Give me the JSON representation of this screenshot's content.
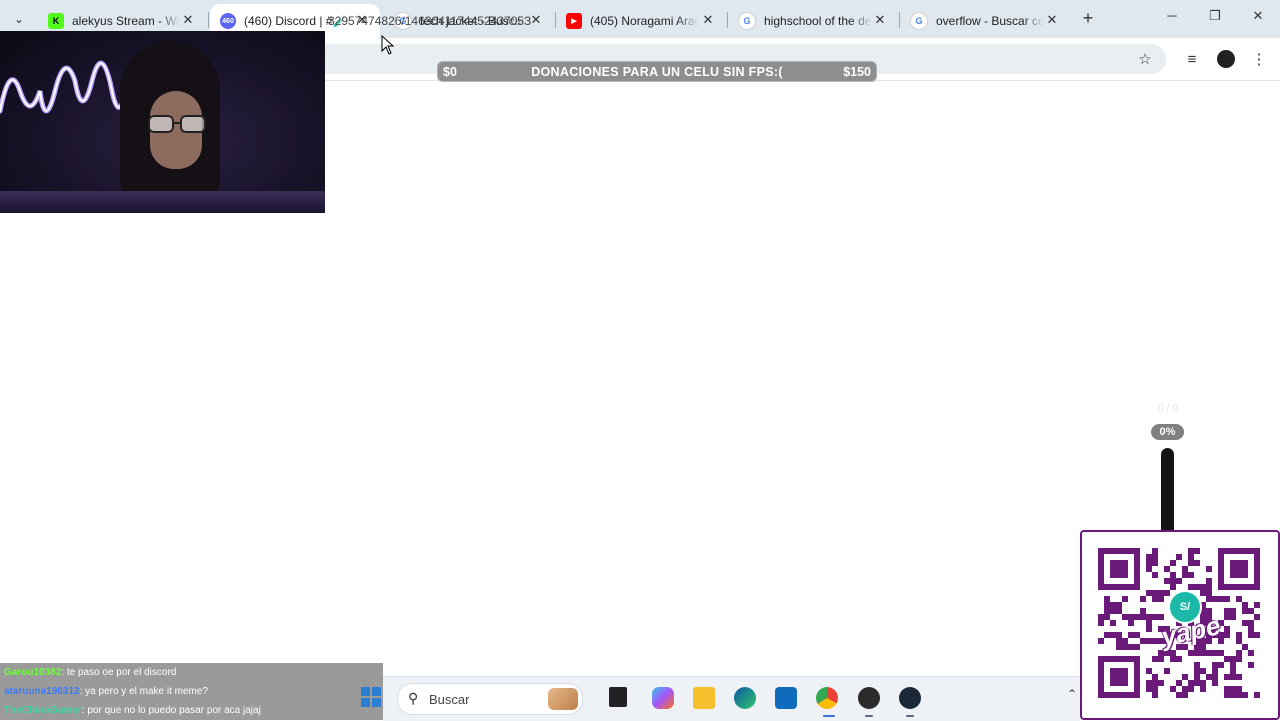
{
  "browser": {
    "tabs": [
      {
        "title": "alekyus Stream - Wat",
        "favicon": "kick-icon",
        "color": "#53fc18",
        "glyph": "K",
        "active": false
      },
      {
        "title": "(460) Discord | #🧪",
        "favicon": "discord-icon",
        "color": "#5865f2",
        "glyph": "460",
        "active": true
      },
      {
        "title": "tech jacket - Buscar c",
        "favicon": "google-icon",
        "color": "#4285f4",
        "glyph": "G",
        "active": false
      },
      {
        "title": "(405) Noragami Arag",
        "favicon": "youtube-icon",
        "color": "#ff0000",
        "glyph": "▶",
        "active": false
      },
      {
        "title": "highschool of the de",
        "favicon": "google-icon",
        "color": "#4285f4",
        "glyph": "G",
        "active": false
      },
      {
        "title": "overflow - Buscar con",
        "favicon": "google-icon",
        "color": "#4285f4",
        "glyph": "G",
        "active": false
      }
    ],
    "close_glyph": "✕",
    "new_tab_glyph": "+",
    "tab_search_glyph": "⌄",
    "window_controls": {
      "minimize": "─",
      "restore": "❐",
      "close": "✕"
    },
    "url": "32957474826/146304117445243705З",
    "toolbar_icons": {
      "bookmark": "☆",
      "media": "≡",
      "menu": "⋮"
    }
  },
  "donation_bar": {
    "label": "DONACIONES PARA UN CELU SIN FPS:(",
    "min": "$0",
    "max": "$150"
  },
  "goal_meter": {
    "counter": "0 / 0",
    "percent_label": "0%",
    "percent": 0
  },
  "qr": {
    "brand": "yape",
    "badge": "S/",
    "color": "#6a1b7a"
  },
  "chat": [
    {
      "user": "Garou10382",
      "message": ": te paso oe por el discord",
      "color": "#6dff3a"
    },
    {
      "user": "ataruuna190312",
      "message": ": ya pero y el make it meme?",
      "color": "#3a7bff"
    },
    {
      "user": "TheChinoGamer",
      "message": ": por que no lo puedo pasar por aca jajaj",
      "color": "#39d6a8"
    }
  ],
  "taskbar": {
    "search_placeholder": "Buscar",
    "apps": [
      "start-icon",
      "task-view-icon",
      "copilot-icon",
      "file-explorer-icon",
      "edge-icon",
      "outlook-icon",
      "chrome-icon",
      "obs-icon",
      "steam-icon"
    ],
    "tray_chevron": "⌃"
  }
}
